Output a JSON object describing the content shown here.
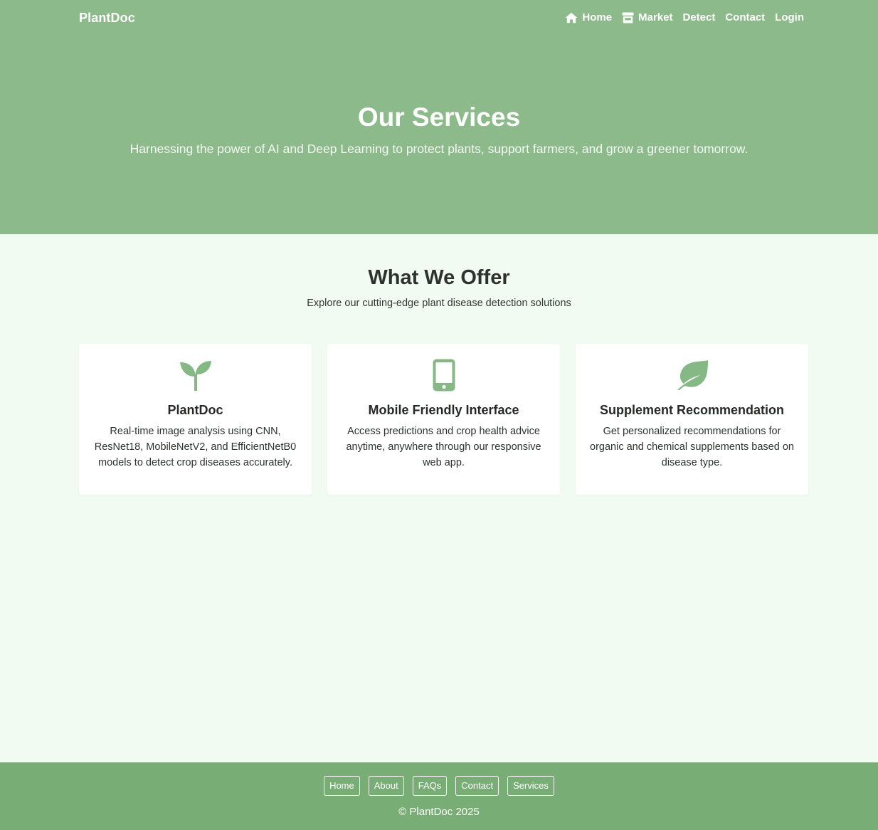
{
  "navbar": {
    "brand": "PlantDoc",
    "links": [
      {
        "label": "Home",
        "icon": "home-icon"
      },
      {
        "label": "Market",
        "icon": "store-icon"
      },
      {
        "label": "Detect"
      },
      {
        "label": "Contact"
      },
      {
        "label": "Login"
      }
    ]
  },
  "hero": {
    "title": "Our Services",
    "subtitle": "Harnessing the power of AI and Deep Learning to protect plants, support farmers, and grow a greener tomorrow."
  },
  "offer": {
    "title": "What We Offer",
    "subtitle": "Explore our cutting-edge plant disease detection solutions",
    "cards": [
      {
        "icon": "seedling-icon",
        "title": "PlantDoc",
        "text": "Real-time image analysis using CNN, ResNet18, MobileNetV2, and EfficientNetB0 models to detect crop diseases accurately."
      },
      {
        "icon": "mobile-phone-icon",
        "title": "Mobile Friendly Interface",
        "text": "Access predictions and crop health advice anytime, anywhere through our responsive web app."
      },
      {
        "icon": "leaf-icon",
        "title": "Supplement Recommendation",
        "text": "Get personalized recommendations for organic and chemical supplements based on disease type."
      }
    ]
  },
  "footer": {
    "links": [
      "Home",
      "About",
      "FAQs",
      "Contact",
      "Services"
    ],
    "copyright": "© PlantDoc 2025"
  },
  "colors": {
    "hero_bg": "#8cba8b",
    "page_bg": "#f1fbf2",
    "footer_bg": "#78ae75",
    "icon_green": "#86b886"
  }
}
